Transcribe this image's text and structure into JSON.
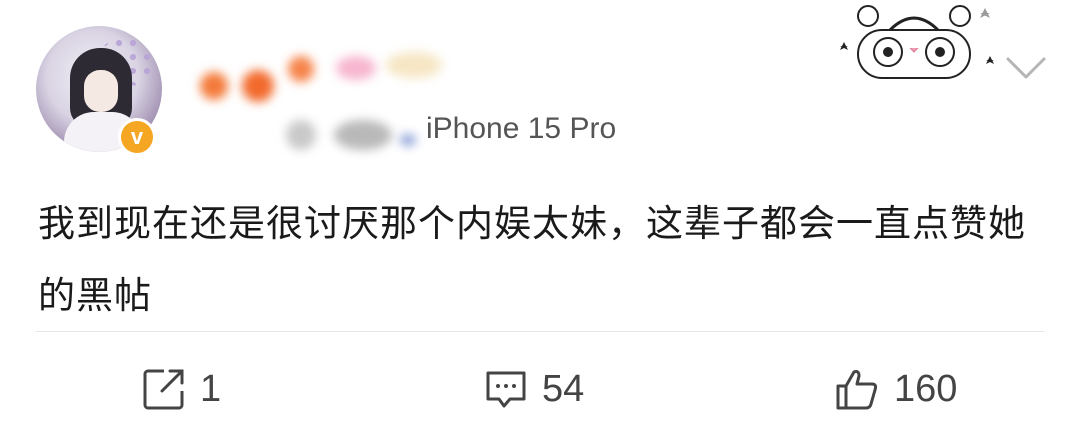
{
  "post": {
    "device": "iPhone 15 Pro",
    "content_part1": "我到现在还是很讨厌那个内娱太妹，这辈子都会一直点赞她的黑帖",
    "content_part2": ""
  },
  "actions": {
    "repost_count": "1",
    "comment_count": "54",
    "like_count": "160"
  },
  "colors": {
    "verified_badge": "#f5a623",
    "text": "#1a1a1a",
    "secondary": "#555555"
  }
}
